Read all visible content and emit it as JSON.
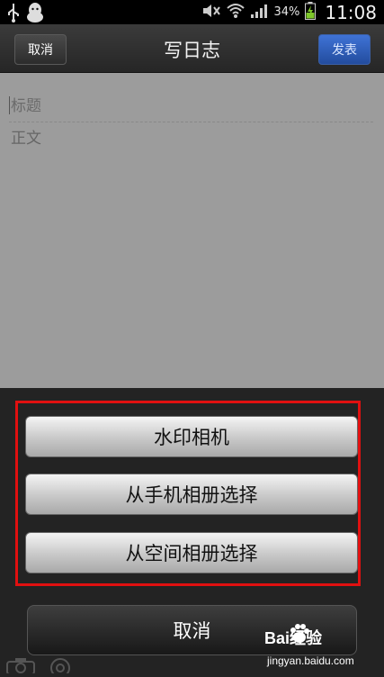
{
  "status_bar": {
    "battery_percent": "34%",
    "time": "11:08",
    "icons": [
      "usb-icon",
      "qq-penguin-icon",
      "mute-icon",
      "wifi-icon",
      "signal-icon",
      "battery-charging-icon"
    ]
  },
  "header": {
    "cancel_label": "取消",
    "title": "写日志",
    "publish_label": "发表"
  },
  "editor": {
    "title_placeholder": "标题",
    "body_placeholder": "正文"
  },
  "action_sheet": {
    "options": [
      "水印相机",
      "从手机相册选择",
      "从空间相册选择"
    ],
    "cancel_label": "取消"
  },
  "bottom_bar": {
    "icons": [
      "camera-icon",
      "at-icon"
    ]
  },
  "watermark": {
    "brand": "Bai经验",
    "url": "jingyan.baidu.com"
  },
  "colors": {
    "highlight_border": "#e01010",
    "publish_button": "#2f5fbd"
  }
}
